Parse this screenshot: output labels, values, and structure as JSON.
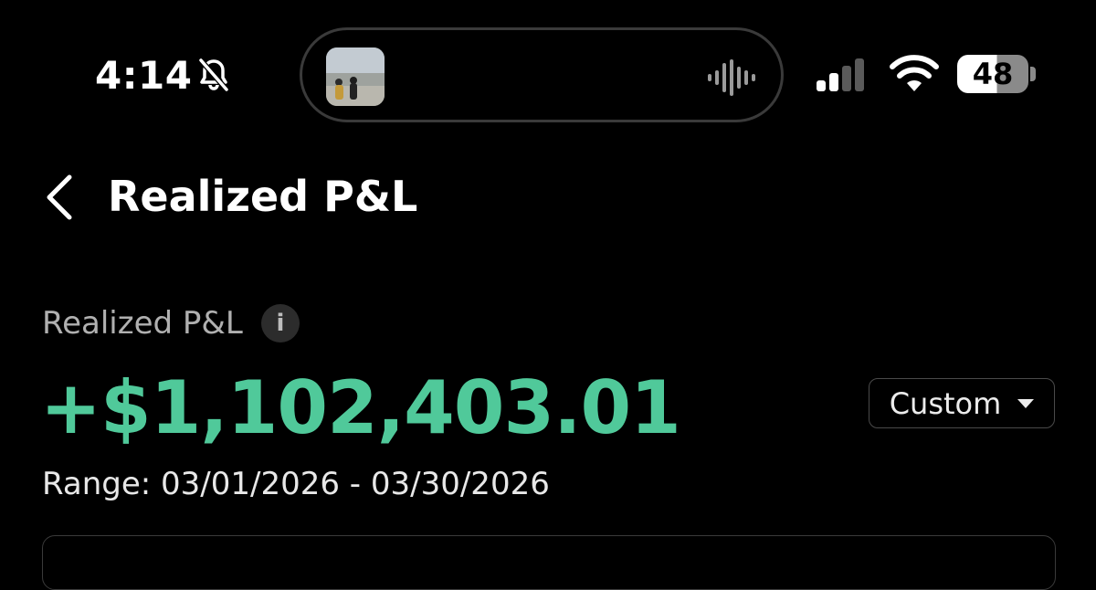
{
  "status_bar": {
    "time": "4:14",
    "battery": "48",
    "icons": [
      "bell-slash-icon",
      "audio-waveform-icon",
      "cellular-signal-icon",
      "wifi-icon",
      "battery-icon"
    ]
  },
  "header": {
    "title": "Realized P&L",
    "back_icon": "chevron-left-icon"
  },
  "summary": {
    "label": "Realized P&L",
    "info_glyph": "i",
    "amount": "+$1,102,403.01",
    "range": "Range: 03/01/2026 - 03/30/2026"
  },
  "period_selector": {
    "value": "Custom"
  },
  "colors": {
    "accent_positive": "#50c99a",
    "background": "#000000",
    "muted_text": "#b0b0b0"
  }
}
